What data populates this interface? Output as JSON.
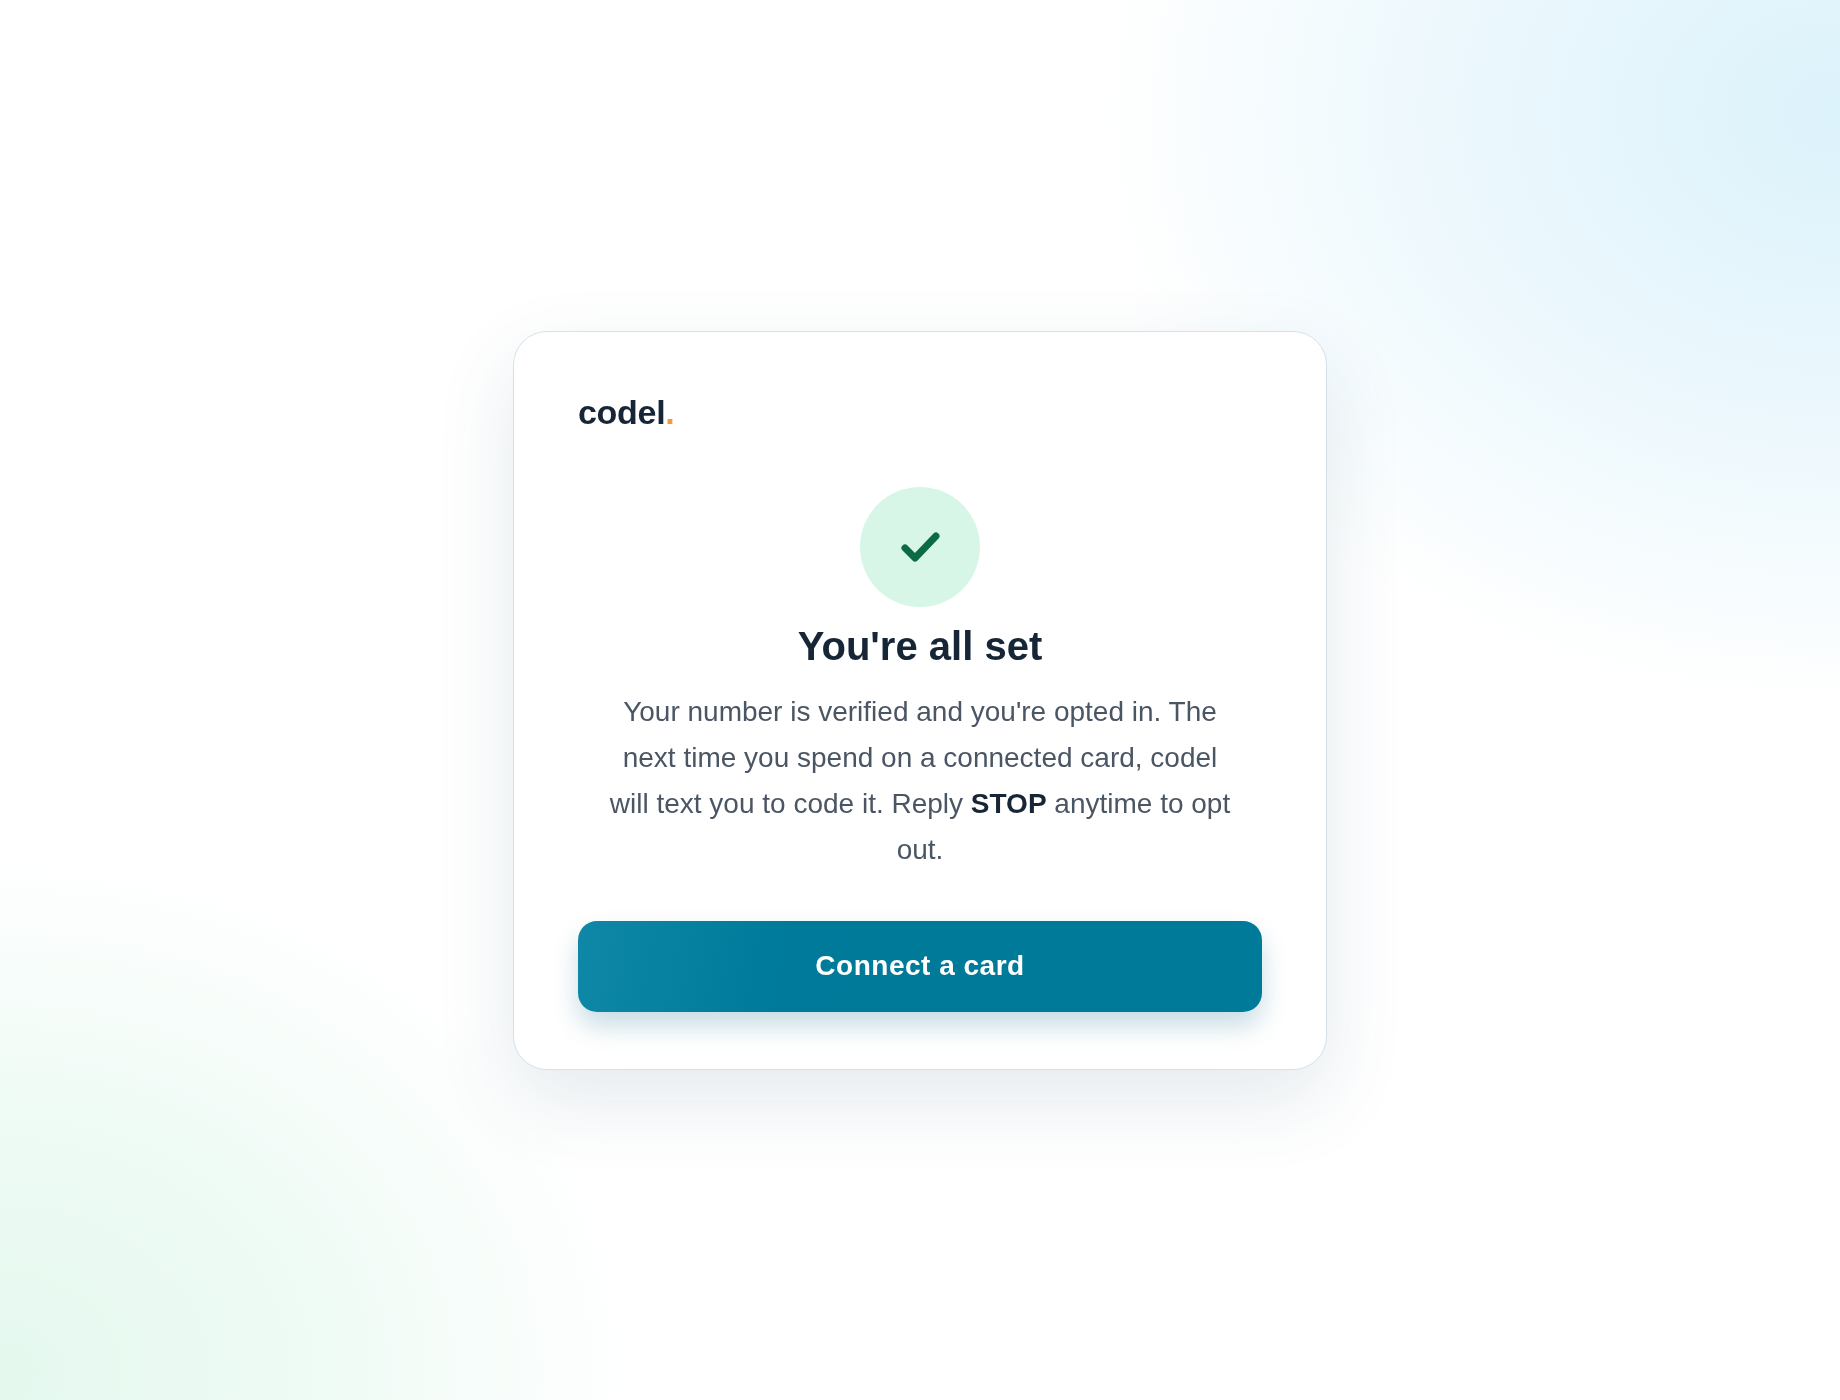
{
  "logo": {
    "text": "codel",
    "dot": "."
  },
  "title": "You're all set",
  "message": "Your number is verified and you're opted in. The next time you spend on a connected card, codel will text you to code it. Reply **STOP** anytime to opt out.",
  "button": {
    "label": "Connect a card"
  }
}
